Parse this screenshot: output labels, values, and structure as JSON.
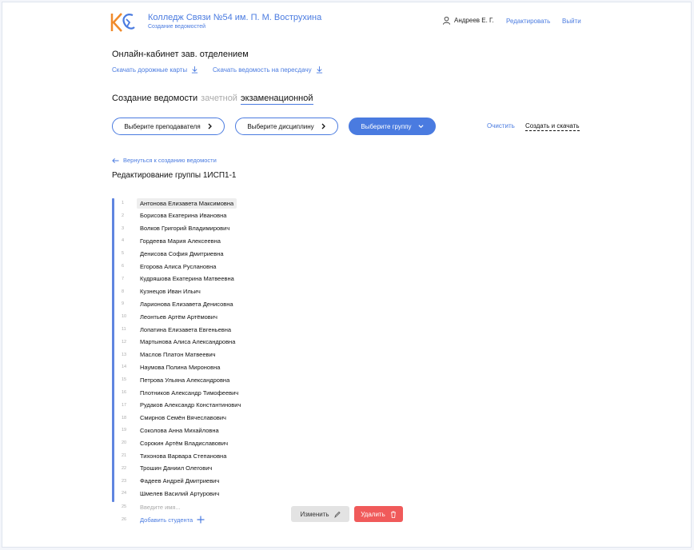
{
  "header": {
    "college_name": "Колледж Связи №54 им. П. М. Вострухина",
    "subtitle": "Создание ведомостей",
    "user_name": "Андреев Е. Г.",
    "edit_link": "Редактировать",
    "logout_link": "Выйти"
  },
  "cabinet": {
    "title": "Онлайн-кабинет зав. отделением",
    "roadmaps_link": "Скачать дорожные карты",
    "retake_link": "Скачать ведомость на пересдачу"
  },
  "creation": {
    "label": "Создание ведомости",
    "option_credit": "зачетной",
    "option_exam": "экзаменационной"
  },
  "selectors": {
    "teacher": "Выберите преподавателя",
    "discipline": "Выберите дисциплину",
    "group": "Выберите группу",
    "clear": "Очистить",
    "create_download": "Создать и скачать"
  },
  "editor": {
    "back_link": "Вернуться к созданию ведомости",
    "title": "Редактирование группы 1ИСП1-1",
    "students": [
      {
        "num": "1",
        "name": "Антонова Елизавета Максимовна"
      },
      {
        "num": "2",
        "name": "Борисова Екатерина Ивановна"
      },
      {
        "num": "3",
        "name": "Волков Григорий Владимирович"
      },
      {
        "num": "4",
        "name": "Гордеева Мария Алексеевна"
      },
      {
        "num": "5",
        "name": "Денисова София Дмитриевна"
      },
      {
        "num": "6",
        "name": "Егорова Алиса Руслановна"
      },
      {
        "num": "7",
        "name": "Кудряшова Екатерина Матвеевна"
      },
      {
        "num": "8",
        "name": "Кузнецов Иван Ильич"
      },
      {
        "num": "9",
        "name": "Ларионова Елизавета Денисовна"
      },
      {
        "num": "10",
        "name": "Леонтьев Артём Артёмович"
      },
      {
        "num": "11",
        "name": "Лопатина Елизавета Евгеньевна"
      },
      {
        "num": "12",
        "name": "Мартынова Алиса Александровна"
      },
      {
        "num": "13",
        "name": "Маслов Платон Матвеевич"
      },
      {
        "num": "14",
        "name": "Наумова Полина Мироновна"
      },
      {
        "num": "15",
        "name": "Петрова Ульяна Александровна"
      },
      {
        "num": "16",
        "name": "Плотников Александр Тимофеевич"
      },
      {
        "num": "17",
        "name": "Рудаков Александр Константинович"
      },
      {
        "num": "18",
        "name": "Смирнов Семён Вячеславович"
      },
      {
        "num": "19",
        "name": "Соколова Анна Михайловна"
      },
      {
        "num": "20",
        "name": "Сорокин Артём Владиславович"
      },
      {
        "num": "21",
        "name": "Тихонова Варвара Степановна"
      },
      {
        "num": "22",
        "name": "Трошин Даниил Олегович"
      },
      {
        "num": "23",
        "name": "Фадеев Андрей Дмитриевич"
      },
      {
        "num": "24",
        "name": "Шмелев Василий Артурович"
      }
    ],
    "input_num": "25",
    "input_placeholder": "Введите имя...",
    "add_num": "26",
    "add_label": "Добавить студента",
    "edit_button": "Изменить",
    "delete_button": "Удалить"
  }
}
